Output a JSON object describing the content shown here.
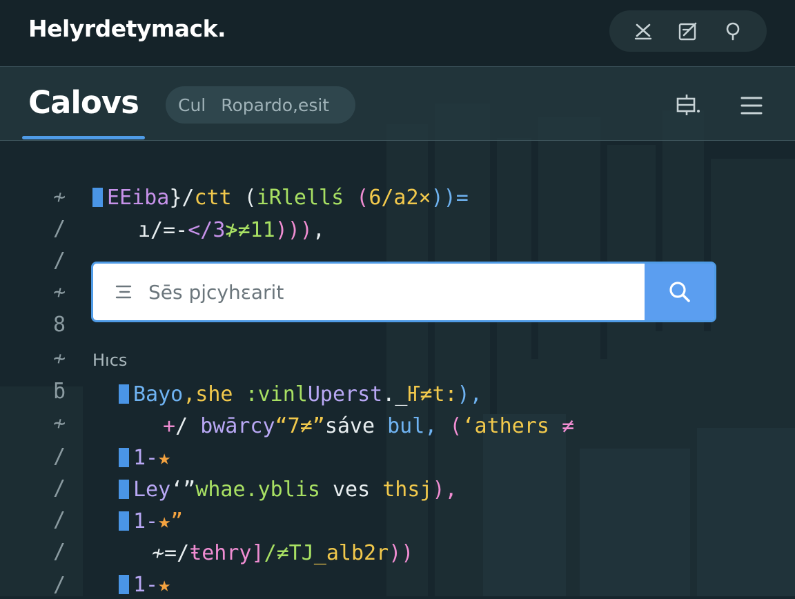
{
  "window": {
    "title": "Helyrdetymack."
  },
  "header": {
    "page_title": "Calovs",
    "filter_left": "Cul",
    "filter_right": "Ropardo,esit"
  },
  "gutter": [
    "≁",
    "/",
    "/",
    "≁",
    "8",
    "≁",
    "ƃ",
    "≁",
    "/",
    "/",
    "/",
    "/",
    "/"
  ],
  "code_top": {
    "line1": {
      "a": "ЕЕiba",
      "b": "}/",
      "c": "ctt",
      "d": " (",
      "e": "iRlellś",
      "f": " (",
      "g": "6/a2×",
      "h": "))="
    },
    "line2": {
      "a": "ı/=-",
      "b": "</3",
      "c": "≯≠11",
      "d": ")))",
      "e": ","
    }
  },
  "search": {
    "placeholder": "Sēs pjcyhɛarit"
  },
  "list": {
    "label": "Hıcs",
    "item1": {
      "a": "Bayo",
      "b": ",she ",
      "c": ":vinl",
      "d": "Uperst",
      "e": ".",
      "f": "_",
      "g": "Ҥ≠t:",
      "h": "),"
    },
    "item1b": {
      "a": "+",
      "b": "/ ",
      "c": "bwārcy",
      "d": "“7≠”",
      "e": "sáve",
      "f": " bul,",
      "g": " (",
      "h": "‘athers",
      "i": " ≠"
    },
    "item2": {
      "a": "1-",
      "b": "★"
    },
    "item3": {
      "a": "Ley",
      "b": "‘”",
      "c": "whae.yblis",
      "d": " ves ",
      "e": "thsj",
      "f": "),"
    },
    "item4": {
      "a": "1-",
      "b": "★”"
    },
    "item4b": {
      "a": "≁=/",
      "b": "ŧehry]",
      "c": "/≠TJ",
      "d": "_alb2r",
      "e": "))"
    },
    "item5": {
      "a": "1-",
      "b": "★"
    }
  },
  "colors": {
    "accent": "#4f9be6",
    "search_button": "#5b9ef0",
    "background": "#17262d"
  }
}
